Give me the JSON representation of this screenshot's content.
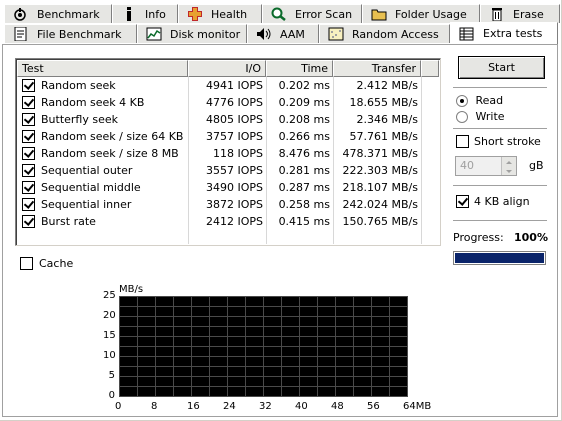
{
  "tabs_top": [
    {
      "label": "Benchmark",
      "icon": "benchmark-icon"
    },
    {
      "label": "Info",
      "icon": "info-icon"
    },
    {
      "label": "Health",
      "icon": "health-icon"
    },
    {
      "label": "Error Scan",
      "icon": "error-scan-icon"
    },
    {
      "label": "Folder Usage",
      "icon": "folder-icon"
    },
    {
      "label": "Erase",
      "icon": "trash-icon"
    }
  ],
  "tabs_bottom": [
    {
      "label": "File Benchmark",
      "icon": "file-benchmark-icon"
    },
    {
      "label": "Disk monitor",
      "icon": "disk-monitor-icon"
    },
    {
      "label": "AAM",
      "icon": "speaker-icon"
    },
    {
      "label": "Random Access",
      "icon": "random-access-icon"
    },
    {
      "label": "Extra tests",
      "icon": "extra-tests-icon"
    }
  ],
  "table": {
    "headers": [
      "Test",
      "I/O",
      "Time",
      "Transfer"
    ],
    "rows": [
      {
        "test": "Random seek",
        "io": "4941 IOPS",
        "time": "0.202 ms",
        "transfer": "2.412 MB/s",
        "checked": true
      },
      {
        "test": "Random seek 4 KB",
        "io": "4776 IOPS",
        "time": "0.209 ms",
        "transfer": "18.655 MB/s",
        "checked": true
      },
      {
        "test": "Butterfly seek",
        "io": "4805 IOPS",
        "time": "0.208 ms",
        "transfer": "2.346 MB/s",
        "checked": true
      },
      {
        "test": "Random seek / size 64 KB",
        "io": "3757 IOPS",
        "time": "0.266 ms",
        "transfer": "57.761 MB/s",
        "checked": true
      },
      {
        "test": "Random seek / size 8 MB",
        "io": "118 IOPS",
        "time": "8.476 ms",
        "transfer": "478.371 MB/s",
        "checked": true
      },
      {
        "test": "Sequential outer",
        "io": "3557 IOPS",
        "time": "0.281 ms",
        "transfer": "222.303 MB/s",
        "checked": true
      },
      {
        "test": "Sequential middle",
        "io": "3490 IOPS",
        "time": "0.287 ms",
        "transfer": "218.107 MB/s",
        "checked": true
      },
      {
        "test": "Sequential inner",
        "io": "3872 IOPS",
        "time": "0.258 ms",
        "transfer": "242.024 MB/s",
        "checked": true
      },
      {
        "test": "Burst rate",
        "io": "2412 IOPS",
        "time": "0.415 ms",
        "transfer": "150.765 MB/s",
        "checked": true
      }
    ]
  },
  "controls": {
    "start_label": "Start",
    "read_label": "Read",
    "write_label": "Write",
    "mode_selected": "Read",
    "short_stroke_label": "Short stroke",
    "short_stroke_checked": false,
    "short_stroke_value": "40",
    "short_stroke_unit": "gB",
    "align_label": "4 KB align",
    "align_checked": true,
    "progress_label": "Progress:",
    "progress_value": "100%",
    "progress_fraction": 1.0,
    "cache_label": "Cache",
    "cache_checked": false
  },
  "colors": {
    "progress_fill": "#0a246a",
    "chart_bg": "#000000",
    "chart_grid": "#4a4a4a"
  },
  "chart_data": {
    "type": "line",
    "ylabel": "MB/s",
    "yticks": [
      "25",
      "20",
      "15",
      "10",
      "5",
      "0"
    ],
    "xticks": [
      "0",
      "8",
      "16",
      "24",
      "32",
      "40",
      "48",
      "56",
      "64MB"
    ],
    "ylim": [
      0,
      25
    ],
    "xlim": [
      0,
      64
    ],
    "grid": true,
    "series": []
  }
}
